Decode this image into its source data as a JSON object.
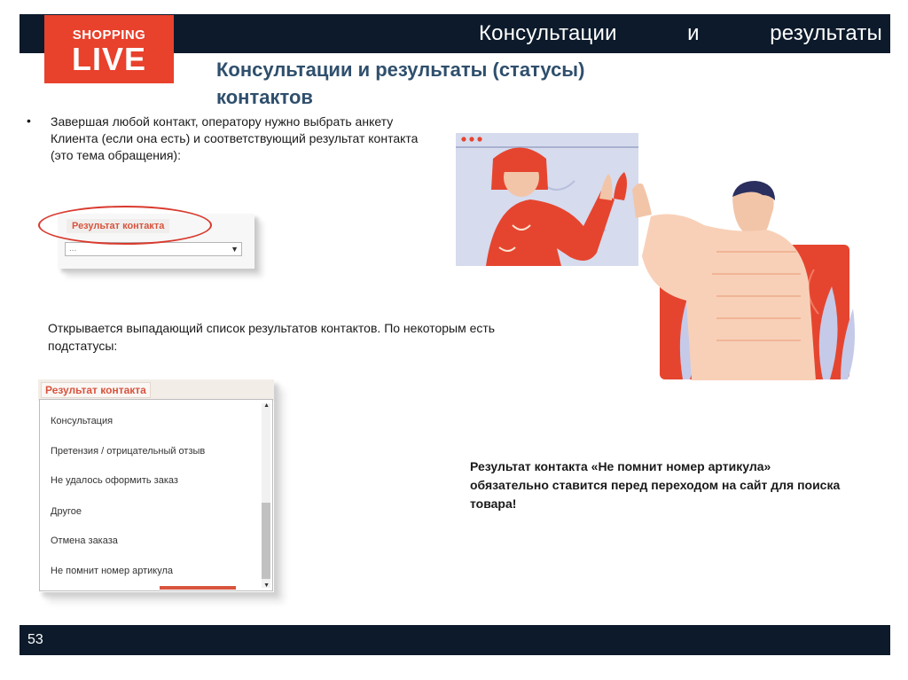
{
  "header": {
    "title_words": [
      "Консультации",
      "и",
      "результаты"
    ]
  },
  "logo": {
    "line1": "SHOPPING",
    "line2": "LIVE"
  },
  "heading": {
    "text": "Консультации и результаты (статусы) контактов"
  },
  "intro": {
    "bullet": "•",
    "text": "Завершая любой контакт, оператору нужно выбрать анкету Клиента (если она есть) и соответствующий результат контакта (это тема обращения):"
  },
  "field_screenshot": {
    "label": "Результат контакта",
    "value": "...",
    "arrow": "▼"
  },
  "dropdown_intro": {
    "text": "Открывается выпадающий список результатов контактов. По некоторым есть подстатусы:"
  },
  "dropdown_screenshot": {
    "label": "Результат контакта",
    "options": [
      "Консультация",
      "Претензия / отрицательный отзыв",
      "Не удалось оформить заказ",
      "Другое",
      "Отмена заказа",
      "Не помнит номер артикула"
    ],
    "scroll_up": "▲",
    "scroll_down": "▼"
  },
  "note": {
    "text": "Результат контакта «Не помнит номер артикула» обязательно ставится перед переходом на сайт для поиска товара!"
  },
  "footer": {
    "page": "53"
  },
  "colors": {
    "navy": "#0c1a2b",
    "brand_red": "#e8412c",
    "heading_blue": "#2f4f6d",
    "highlight_red": "#d93a2e"
  },
  "illustration": {
    "icon": "high-five-illustration"
  }
}
